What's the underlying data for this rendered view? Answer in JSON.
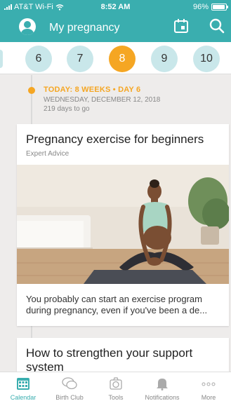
{
  "status_bar": {
    "carrier": "AT&T Wi-Fi",
    "time": "8:52 AM",
    "battery": "96%",
    "battery_level": 0.96
  },
  "header": {
    "title": "My pregnancy",
    "icons": [
      "profile-icon",
      "calendar-icon",
      "search-icon"
    ]
  },
  "weeks": {
    "items": [
      "6",
      "7",
      "8",
      "9",
      "10"
    ],
    "selected": "8"
  },
  "today": {
    "label": "TODAY: 8 WEEKS • DAY 6",
    "date": "WEDNESDAY, DECEMBER 12, 2018",
    "days_left": "219 days to go"
  },
  "cards": [
    {
      "title": "Pregnancy exercise for beginners",
      "category": "Expert Advice",
      "snippet": "You probably can start an exercise program during pregnancy, even if you've been a de..."
    },
    {
      "title": "How to strengthen your support system"
    }
  ],
  "tabbar": {
    "items": [
      {
        "label": "Calendar",
        "icon": "calendar-icon",
        "active": true
      },
      {
        "label": "Birth Club",
        "icon": "chat-bubbles-icon",
        "active": false
      },
      {
        "label": "Tools",
        "icon": "tools-icon",
        "active": false
      },
      {
        "label": "Notifications",
        "icon": "bell-icon",
        "active": false
      },
      {
        "label": "More",
        "icon": "more-dots-icon",
        "active": false
      }
    ]
  },
  "colors": {
    "brand": "#3aaeaf",
    "accent": "#f5a623",
    "week_bubble": "#c9e7ea"
  }
}
